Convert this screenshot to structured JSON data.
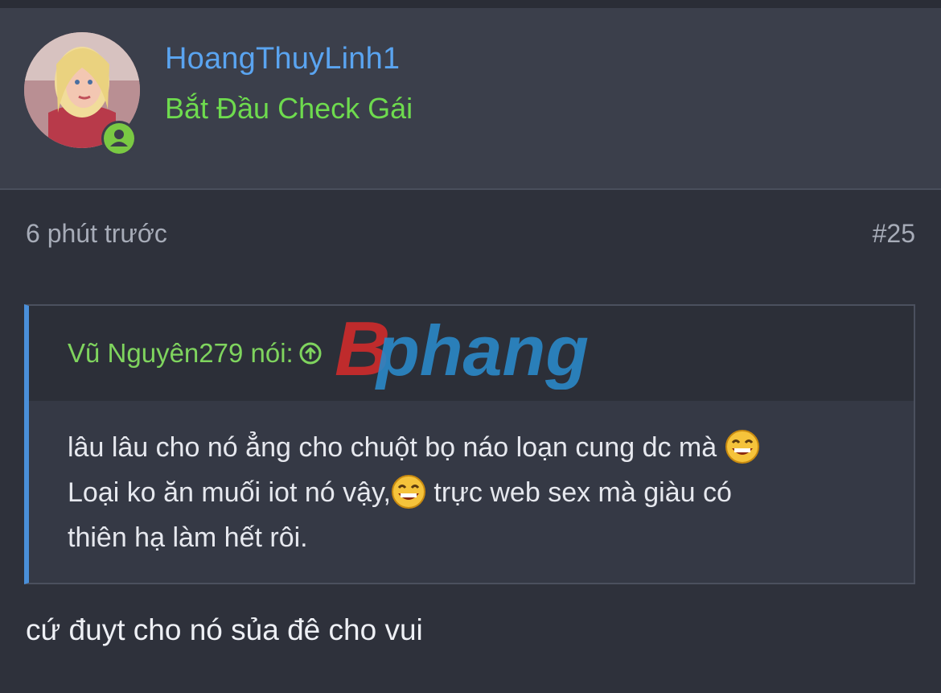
{
  "post": {
    "username": "HoangThuyLinh1",
    "user_title": "Bắt Đầu Check Gái",
    "time": "6 phút trước",
    "post_number": "#25",
    "quote": {
      "author": "Vũ Nguyên279 nói:",
      "line1": "lâu lâu cho nó ẳng cho chuột bọ náo loạn cung dc mà",
      "line2a": "Loại ko ăn muối iot nó vậy,",
      "line2b": " trực web sex mà giàu có",
      "line3": "thiên hạ làm hết rôi."
    },
    "reply": "cứ đuyt cho nó sủa đê cho vui"
  },
  "watermark": {
    "text": "phang",
    "letter": "B"
  },
  "icons": {
    "online": "user-online-icon",
    "goto": "arrow-up-circle-icon",
    "emoji": "laughing-emoji-icon"
  },
  "colors": {
    "username": "#5aa4f0",
    "user_title": "#6edb4e",
    "quote_bar": "#4a8fd9",
    "background": "#2e313b",
    "header": "#3b3f4b"
  }
}
